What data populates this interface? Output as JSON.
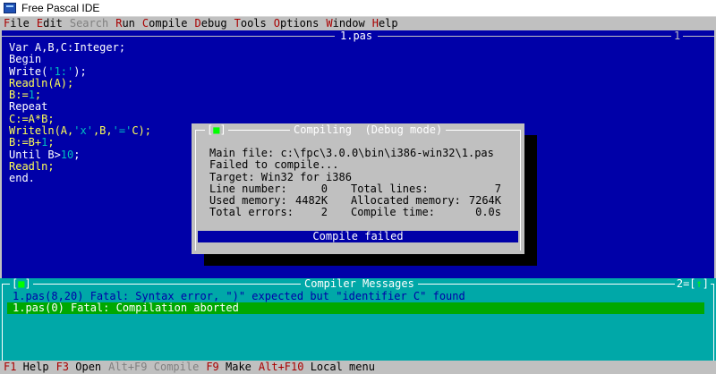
{
  "window": {
    "title": "Free Pascal IDE"
  },
  "menu": {
    "items": [
      {
        "hot": "F",
        "rest": "ile",
        "enabled": true
      },
      {
        "hot": "E",
        "rest": "dit",
        "enabled": true
      },
      {
        "hot": "S",
        "rest": "earch",
        "enabled": false
      },
      {
        "hot": "R",
        "rest": "un",
        "enabled": true
      },
      {
        "hot": "C",
        "rest": "ompile",
        "enabled": true
      },
      {
        "hot": "D",
        "rest": "ebug",
        "enabled": true
      },
      {
        "hot": "T",
        "rest": "ools",
        "enabled": true
      },
      {
        "hot": "O",
        "rest": "ptions",
        "enabled": true
      },
      {
        "hot": "W",
        "rest": "indow",
        "enabled": true
      },
      {
        "hot": "H",
        "rest": "elp",
        "enabled": true
      }
    ]
  },
  "editor": {
    "title": "1.pas",
    "window_number": "1",
    "lines": [
      [
        {
          "t": "Var A,B,C:Integer;",
          "c": "w"
        }
      ],
      [
        {
          "t": "Begin",
          "c": "w"
        }
      ],
      [
        {
          "t": "Write(",
          "c": "w"
        },
        {
          "t": "'1:'",
          "c": "c"
        },
        {
          "t": ");",
          "c": "w"
        }
      ],
      [
        {
          "t": "Readln(A);",
          "c": "y"
        }
      ],
      [
        {
          "t": "B:=",
          "c": "y"
        },
        {
          "t": "1",
          "c": "c"
        },
        {
          "t": ";",
          "c": "y"
        }
      ],
      [
        {
          "t": "Repeat",
          "c": "w"
        }
      ],
      [
        {
          "t": "C:=A*B;",
          "c": "y"
        }
      ],
      [
        {
          "t": "Writeln(A,",
          "c": "y"
        },
        {
          "t": "'x'",
          "c": "c"
        },
        {
          "t": ",B,",
          "c": "y"
        },
        {
          "t": "'='",
          "c": "c"
        },
        {
          "t": "C);",
          "c": "y"
        }
      ],
      [
        {
          "t": "B:=B+",
          "c": "y"
        },
        {
          "t": "1",
          "c": "c"
        },
        {
          "t": ";",
          "c": "y"
        }
      ],
      [
        {
          "t": "Until B>",
          "c": "w"
        },
        {
          "t": "10",
          "c": "c"
        },
        {
          "t": ";",
          "c": "w"
        }
      ],
      [
        {
          "t": "Readln;",
          "c": "y"
        }
      ],
      [
        {
          "t": "end.",
          "c": "w"
        }
      ]
    ]
  },
  "compile_dialog": {
    "close_left": "[",
    "close_glyph": "■",
    "close_right": "]",
    "title": "Compiling  (Debug mode)",
    "main_file": "Main file: c:\\fpc\\3.0.0\\bin\\i386-win32\\1.pas",
    "status_line": "Failed to compile...",
    "target": "Target: Win32 for i386",
    "stats": [
      {
        "l_label": "Line number:",
        "l_value": "0",
        "r_label": "Total lines:",
        "r_value": "7"
      },
      {
        "l_label": "Used memory:",
        "l_value": "4482K",
        "r_label": "Allocated memory:",
        "r_value": "7264K"
      },
      {
        "l_label": "Total errors:",
        "l_value": "2",
        "r_label": "Compile time:",
        "r_value": "0.0s"
      }
    ],
    "result": "Compile failed"
  },
  "messages": {
    "title": "Compiler Messages",
    "close_left": "[",
    "close_glyph": "■",
    "close_right": "]",
    "right_prefix": "2=[",
    "right_glyph": "↑",
    "right_suffix": "]",
    "items": [
      {
        "text": "1.pas(8,20) Fatal: Syntax error, \")\" expected but \"identifier C\" found",
        "selected": false
      },
      {
        "text": "1.pas(0) Fatal: Compilation aborted",
        "selected": true
      }
    ]
  },
  "statusbar": {
    "items": [
      {
        "key": "F1",
        "label": " Help",
        "enabled": true
      },
      {
        "key": "F3",
        "label": " Open",
        "enabled": true
      },
      {
        "key": "Alt+F9",
        "label": " Compile",
        "enabled": false
      },
      {
        "key": "F9",
        "label": " Make",
        "enabled": true
      },
      {
        "key": "Alt+F10",
        "label": " Local menu",
        "enabled": true
      }
    ]
  },
  "colors": {
    "editor_bg": "#0000a8",
    "menu_bg": "#c0c0c0",
    "hotkey": "#a80000",
    "messages_bg": "#00a8a8",
    "selected_bg": "#00a800"
  }
}
